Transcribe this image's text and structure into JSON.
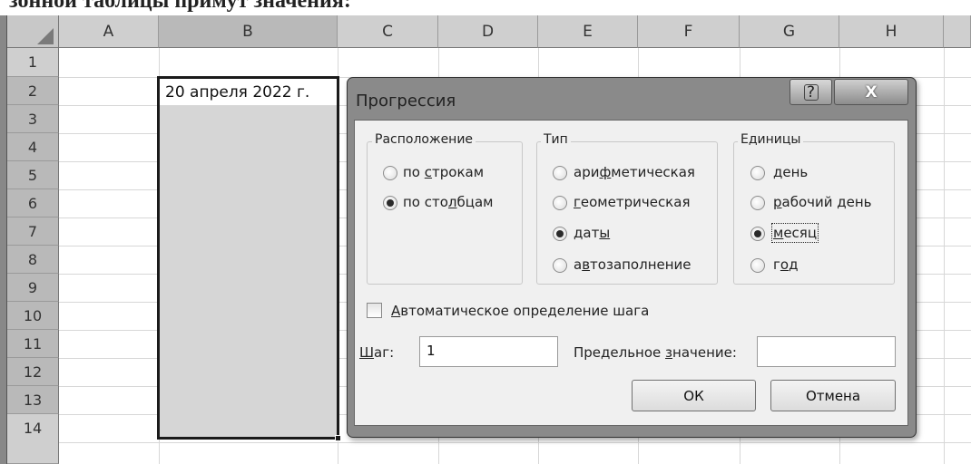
{
  "page": {
    "caption": "зонной таблицы примут значения:"
  },
  "sheet": {
    "columns": [
      "A",
      "B",
      "C",
      "D",
      "E",
      "F",
      "G",
      "H"
    ],
    "rows": [
      "1",
      "2",
      "3",
      "4",
      "5",
      "6",
      "7",
      "8",
      "9",
      "10",
      "11",
      "12",
      "13",
      "14"
    ],
    "cell_b2": "20 апреля 2022 г."
  },
  "dialog": {
    "title": "Прогрессия",
    "help_symbol": "?",
    "close_symbol": "X",
    "layout_group": {
      "label": "Расположение",
      "options": [
        {
          "pre": "по ",
          "ul": "с",
          "post": "трокам",
          "selected": false
        },
        {
          "pre": "по сто",
          "ul": "л",
          "post": "бцам",
          "selected": true
        }
      ]
    },
    "type_group": {
      "label": "Тип",
      "options": [
        {
          "pre": "ари",
          "ul": "ф",
          "post": "метическая",
          "selected": false
        },
        {
          "pre": "",
          "ul": "г",
          "post": "еометрическая",
          "selected": false
        },
        {
          "pre": "дат",
          "ul": "ы",
          "post": "",
          "selected": true
        },
        {
          "pre": "а",
          "ul": "в",
          "post": "тозаполнение",
          "selected": false
        }
      ]
    },
    "units_group": {
      "label": "Единицы",
      "options": [
        {
          "pre": "",
          "ul": "д",
          "post": "ень",
          "selected": false
        },
        {
          "pre": "",
          "ul": "р",
          "post": "абочий день",
          "selected": false
        },
        {
          "pre": "",
          "ul": "м",
          "post": "есяц",
          "selected": true
        },
        {
          "pre": "г",
          "ul": "о",
          "post": "д",
          "selected": false
        }
      ]
    },
    "auto_step": {
      "ul": "А",
      "rest": "втоматическое определение шага",
      "checked": false
    },
    "step": {
      "ul": "Ш",
      "rest": "аг:",
      "value": "1"
    },
    "limit": {
      "pre": "Предельное ",
      "ul": "з",
      "post": "начение:",
      "value": ""
    },
    "ok_label": "ОК",
    "cancel_label": "Отмена"
  }
}
